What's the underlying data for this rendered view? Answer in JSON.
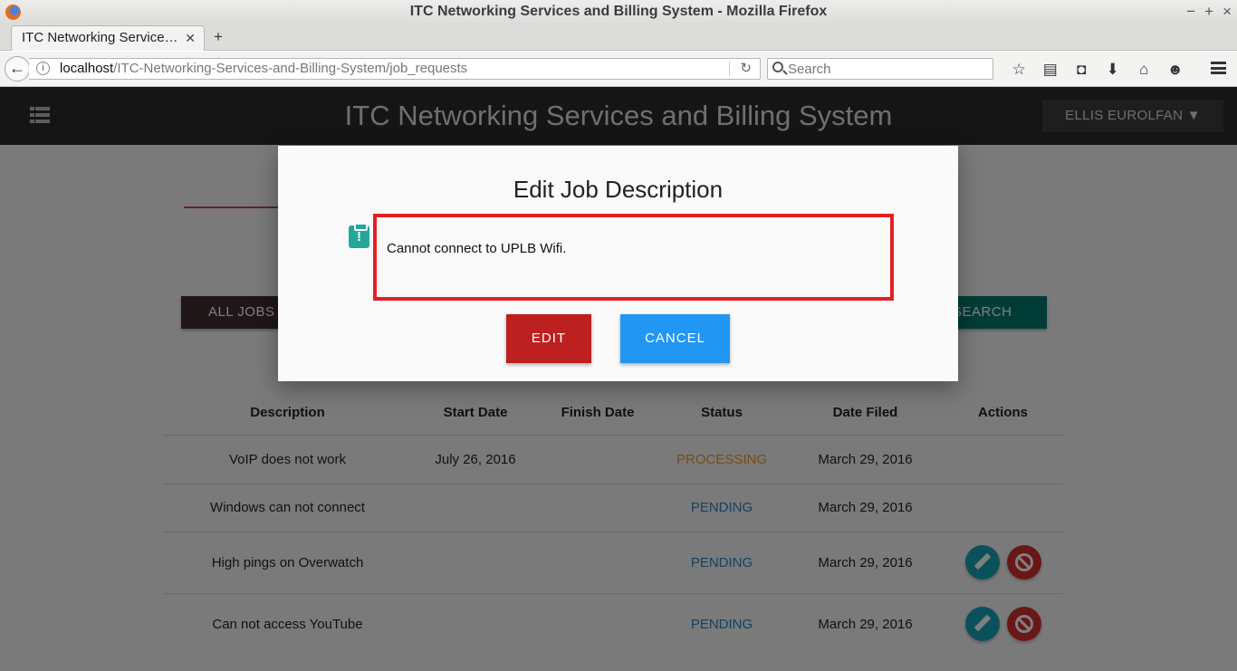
{
  "browser": {
    "window_title": "ITC Networking Services and Billing System - Mozilla Firefox",
    "tab_title": "ITC Networking Service…",
    "url_host": "localhost",
    "url_path": "/ITC-Networking-Services-and-Billing-System/job_requests",
    "search_placeholder": "Search"
  },
  "header": {
    "app_title": "ITC Networking Services and Billing System",
    "user_menu": "ELLIS EUROLFAN ▼"
  },
  "filters": {
    "all_jobs": "ALL JOBS",
    "search_jobs": "SEARCH JOBS..."
  },
  "table": {
    "columns": [
      "Description",
      "Start Date",
      "Finish Date",
      "Status",
      "Date Filed",
      "Actions"
    ],
    "rows": [
      {
        "description": "VoIP does not work",
        "start": "July 26, 2016",
        "finish": "",
        "status": "PROCESSING",
        "filed": "March 29, 2016"
      },
      {
        "description": "Windows can not connect",
        "start": "",
        "finish": "",
        "status": "PENDING",
        "filed": "March 29, 2016"
      },
      {
        "description": "High pings on Overwatch",
        "start": "",
        "finish": "",
        "status": "PENDING",
        "filed": "March 29, 2016"
      },
      {
        "description": "Can not access YouTube",
        "start": "",
        "finish": "",
        "status": "PENDING",
        "filed": "March 29, 2016"
      }
    ]
  },
  "modal": {
    "title": "Edit Job Description",
    "description_value": "Cannot connect to UPLB Wifi.",
    "edit_label": "EDIT",
    "cancel_label": "CANCEL"
  },
  "colors": {
    "header_bg": "#2b2b2b",
    "processing": "#ef9a1f",
    "pending": "#2d83c0",
    "edit_btn": "#bd2020",
    "cancel_btn": "#2196f3",
    "highlight_border": "#e32025"
  },
  "icons": [
    "firefox-logo-icon",
    "back-arrow-icon",
    "info-icon",
    "reload-icon",
    "search-icon",
    "bookmark-star-icon",
    "reading-list-icon",
    "pocket-icon",
    "download-icon",
    "home-icon",
    "chat-icon",
    "hamburger-menu-icon",
    "clipboard-alert-icon",
    "pencil-icon",
    "ban-icon"
  ]
}
